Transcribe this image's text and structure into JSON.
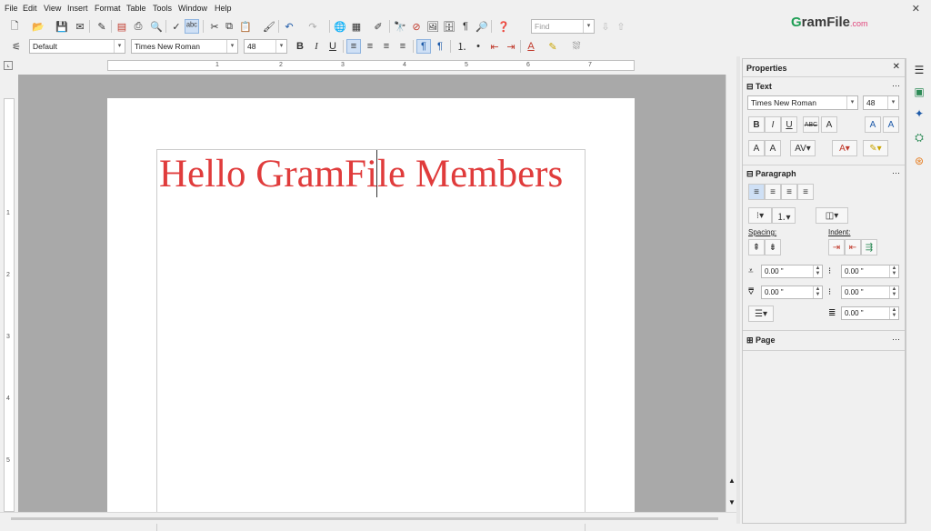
{
  "menubar": {
    "items": [
      "File",
      "Edit",
      "View",
      "Insert",
      "Format",
      "Table",
      "Tools",
      "Window",
      "Help"
    ],
    "close_glyph": "✕"
  },
  "toolbar": {
    "find_placeholder": "Find",
    "brand_g": "G",
    "brand_name": "ramFile",
    "brand_com": ".com"
  },
  "format_bar": {
    "paragraph_style": "Default",
    "font_name": "Times New Roman",
    "font_size": "48",
    "bold": "B",
    "italic": "I",
    "underline": "U"
  },
  "ruler": {
    "labels": [
      "1",
      "2",
      "3",
      "4",
      "5",
      "6",
      "7"
    ]
  },
  "vruler": {
    "labels": [
      "1",
      "2",
      "3",
      "4",
      "5"
    ]
  },
  "document": {
    "text": "Hello GramFile Members"
  },
  "sidebar": {
    "title": "Properties",
    "text_section": "Text",
    "font_name": "Times New Roman",
    "font_size": "48",
    "paragraph_section": "Paragraph",
    "spacing_label": "Spacing:",
    "indent_label": "Indent:",
    "spacing_above": "0.00 \"",
    "spacing_below": "0.00 \"",
    "indent_before": "0.00 \"",
    "indent_after": "0.00 \"",
    "indent_first": "0.00 \"",
    "page_section": "Page"
  },
  "colors": {
    "doc_text": "#e03c3c",
    "brand_green": "#1e9e54",
    "brand_pink": "#e0457b"
  }
}
